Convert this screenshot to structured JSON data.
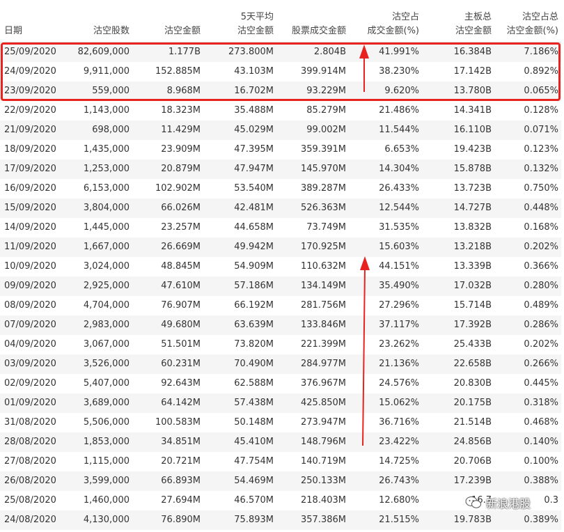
{
  "columns": [
    {
      "key": "date",
      "line1": "",
      "line2": "日期"
    },
    {
      "key": "shares",
      "line1": "",
      "line2": "沽空股数"
    },
    {
      "key": "amount",
      "line1": "",
      "line2": "沽空金额"
    },
    {
      "key": "avg5",
      "line1": "5天平均",
      "line2": "沽空金额"
    },
    {
      "key": "turnover",
      "line1": "",
      "line2": "股票成交金额"
    },
    {
      "key": "ratio",
      "line1": "沽空占",
      "line2": "成交金额(%)"
    },
    {
      "key": "board",
      "line1": "主板总",
      "line2": "沽空金额"
    },
    {
      "key": "boardratio",
      "line1": "沽空占总",
      "line2": "沽空金额(%)"
    }
  ],
  "rows": [
    [
      "25/09/2020",
      "82,609,000",
      "1.177B",
      "273.800M",
      "2.804B",
      "41.991%",
      "16.384B",
      "7.186%"
    ],
    [
      "24/09/2020",
      "9,911,000",
      "152.885M",
      "43.103M",
      "399.914M",
      "38.230%",
      "17.142B",
      "0.892%"
    ],
    [
      "23/09/2020",
      "559,000",
      "8.968M",
      "16.702M",
      "93.229M",
      "9.620%",
      "13.780B",
      "0.065%"
    ],
    [
      "22/09/2020",
      "1,143,000",
      "18.323M",
      "35.488M",
      "85.279M",
      "21.486%",
      "14.341B",
      "0.128%"
    ],
    [
      "21/09/2020",
      "698,000",
      "11.429M",
      "45.029M",
      "99.002M",
      "11.544%",
      "16.110B",
      "0.071%"
    ],
    [
      "18/09/2020",
      "1,435,000",
      "23.909M",
      "47.395M",
      "359.391M",
      "6.653%",
      "19.423B",
      "0.123%"
    ],
    [
      "17/09/2020",
      "1,253,000",
      "20.879M",
      "47.947M",
      "145.970M",
      "14.304%",
      "15.878B",
      "0.132%"
    ],
    [
      "16/09/2020",
      "6,153,000",
      "102.902M",
      "53.540M",
      "389.287M",
      "26.433%",
      "13.723B",
      "0.750%"
    ],
    [
      "15/09/2020",
      "3,804,000",
      "66.026M",
      "42.481M",
      "526.363M",
      "12.544%",
      "14.727B",
      "0.448%"
    ],
    [
      "14/09/2020",
      "1,445,000",
      "23.257M",
      "44.658M",
      "73.749M",
      "31.535%",
      "13.832B",
      "0.168%"
    ],
    [
      "11/09/2020",
      "1,667,000",
      "26.669M",
      "49.942M",
      "170.925M",
      "15.603%",
      "13.218B",
      "0.202%"
    ],
    [
      "10/09/2020",
      "3,024,000",
      "48.845M",
      "54.909M",
      "110.632M",
      "44.151%",
      "13.339B",
      "0.366%"
    ],
    [
      "09/09/2020",
      "2,925,000",
      "47.610M",
      "57.186M",
      "134.149M",
      "35.490%",
      "17.032B",
      "0.280%"
    ],
    [
      "08/09/2020",
      "4,704,000",
      "76.907M",
      "66.192M",
      "281.756M",
      "27.296%",
      "15.714B",
      "0.489%"
    ],
    [
      "07/09/2020",
      "2,983,000",
      "49.680M",
      "63.639M",
      "133.846M",
      "37.117%",
      "17.392B",
      "0.286%"
    ],
    [
      "04/09/2020",
      "3,067,000",
      "51.501M",
      "73.820M",
      "221.399M",
      "23.262%",
      "25.433B",
      "0.202%"
    ],
    [
      "03/09/2020",
      "3,526,000",
      "60.231M",
      "70.490M",
      "284.977M",
      "21.136%",
      "22.658B",
      "0.266%"
    ],
    [
      "02/09/2020",
      "5,407,000",
      "92.643M",
      "62.588M",
      "376.967M",
      "24.576%",
      "20.830B",
      "0.445%"
    ],
    [
      "01/09/2020",
      "3,689,000",
      "64.142M",
      "57.438M",
      "425.850M",
      "15.062%",
      "20.175B",
      "0.318%"
    ],
    [
      "31/08/2020",
      "5,506,000",
      "100.583M",
      "50.148M",
      "273.947M",
      "36.716%",
      "21.514B",
      "0.468%"
    ],
    [
      "28/08/2020",
      "1,853,000",
      "34.851M",
      "45.410M",
      "148.796M",
      "23.422%",
      "24.856B",
      "0.140%"
    ],
    [
      "27/08/2020",
      "1,115,000",
      "20.721M",
      "47.754M",
      "140.719M",
      "14.725%",
      "20.706B",
      "0.100%"
    ],
    [
      "26/08/2020",
      "3,599,000",
      "66.893M",
      "54.469M",
      "250.133M",
      "26.743%",
      "17.239B",
      "0.388%"
    ],
    [
      "25/08/2020",
      "1,460,000",
      "27.694M",
      "46.570M",
      "218.403M",
      "12.680%",
      "16.7",
      "0.3"
    ],
    [
      "24/08/2020",
      "4,130,000",
      "76.890M",
      "75.893M",
      "357.386M",
      "21.515%",
      "19.783B",
      "0.389%"
    ]
  ],
  "watermark": {
    "text": "新浪港股",
    "icon": "wechat-icon"
  },
  "colors": {
    "highlight": "#e8231f",
    "stripe": "#f5f5f5"
  }
}
